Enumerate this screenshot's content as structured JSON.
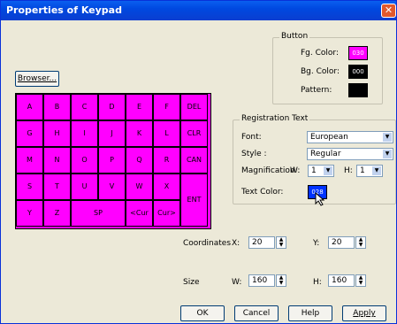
{
  "window": {
    "title": "Properties of Keypad",
    "close_glyph": "✕"
  },
  "browser_button": "Browser...",
  "keypad": {
    "rows": [
      [
        "A",
        "B",
        "C",
        "D",
        "E",
        "F",
        "DEL"
      ],
      [
        "G",
        "H",
        "I",
        "J",
        "K",
        "L",
        "CLR"
      ],
      [
        "M",
        "N",
        "O",
        "P",
        "Q",
        "R",
        "CAN"
      ],
      [
        "S",
        "T",
        "U",
        "V",
        "W",
        "X"
      ],
      [
        "Y",
        "Z"
      ]
    ],
    "sp": "SP",
    "cur_left": "<Cur",
    "cur_right": "Cur>",
    "ent": "ENT",
    "color": "#ff00ff"
  },
  "button_group": {
    "legend": "Button",
    "fg_label": "Fg. Color:",
    "fg_value": "030",
    "fg_color": "#ff00ff",
    "bg_label": "Bg. Color:",
    "bg_value": "000",
    "bg_color": "#000000",
    "pattern_label": "Pattern:",
    "pattern_color": "#000000"
  },
  "registration": {
    "legend": "Registration Text",
    "font_label": "Font:",
    "font_value": "European",
    "style_label": "Style :",
    "style_value": "Regular",
    "magnification_label": "Magnification",
    "w_label": "W:",
    "w_value": "1",
    "h_label": "H:",
    "h_value": "1",
    "text_color_label": "Text Color:",
    "text_color_value": "028",
    "text_color": "#0033ff"
  },
  "coordinates": {
    "label": "Coordinates",
    "x_label": "X:",
    "x_value": "20",
    "y_label": "Y:",
    "y_value": "20"
  },
  "size": {
    "label": "Size",
    "w_label": "W:",
    "w_value": "160",
    "h_label": "H:",
    "h_value": "160"
  },
  "footer": {
    "ok": "OK",
    "cancel": "Cancel",
    "help": "Help",
    "apply": "Apply"
  }
}
